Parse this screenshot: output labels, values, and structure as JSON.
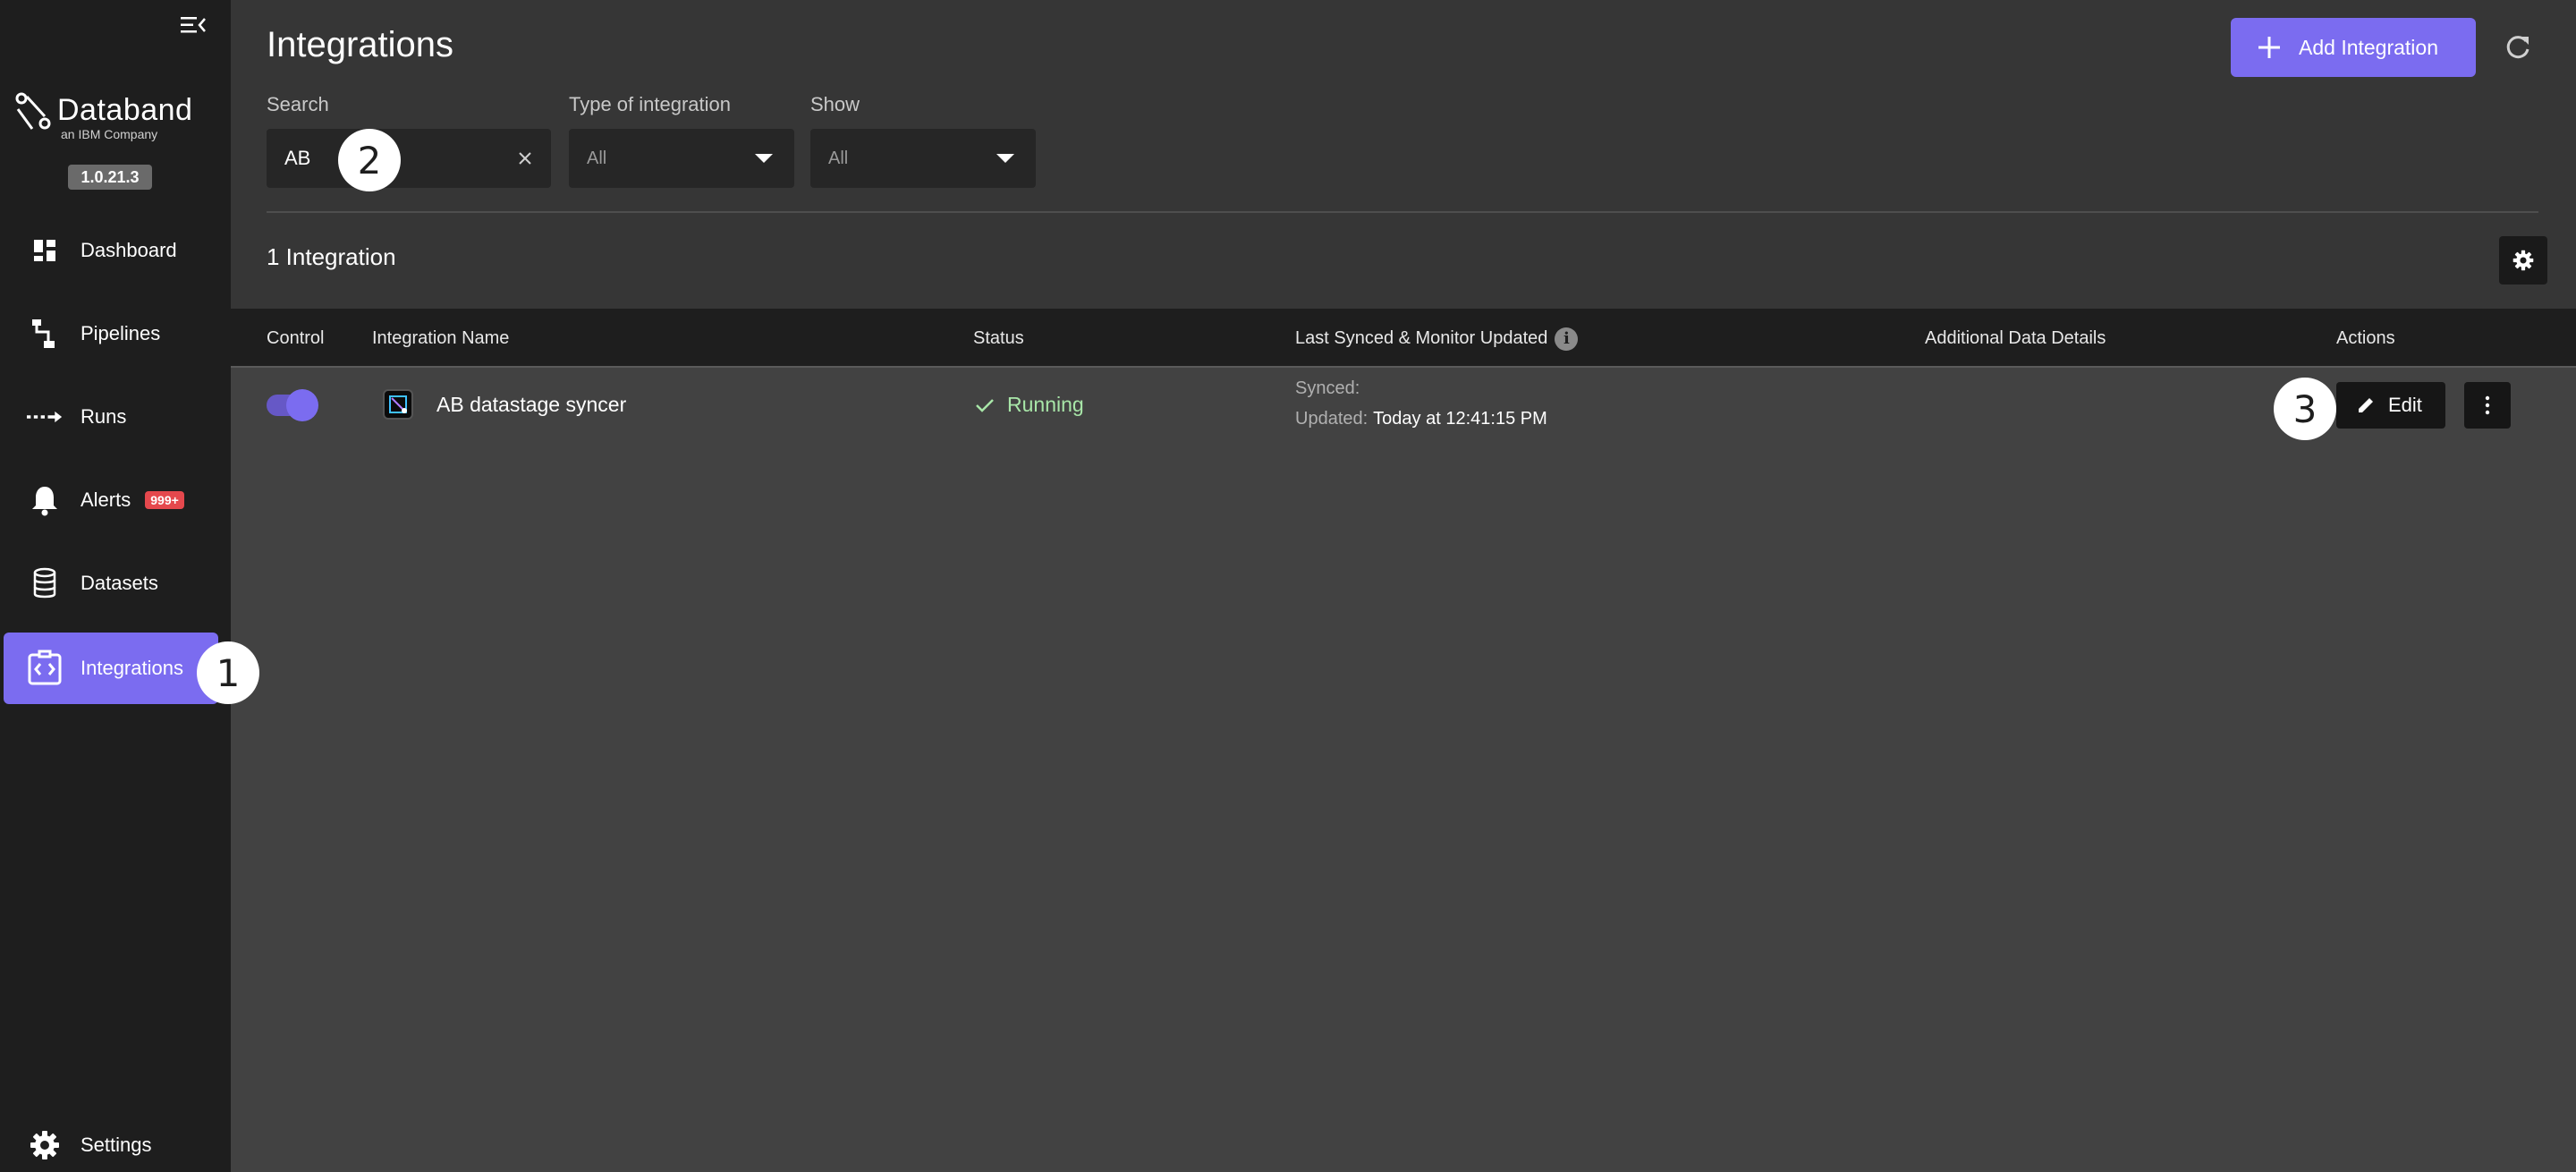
{
  "sidebar": {
    "brand": {
      "name": "Databand",
      "subtitle": "an IBM Company",
      "version": "1.0.21.3"
    },
    "items": [
      {
        "label": "Dashboard",
        "icon": "dashboard-icon"
      },
      {
        "label": "Pipelines",
        "icon": "pipelines-icon"
      },
      {
        "label": "Runs",
        "icon": "runs-icon"
      },
      {
        "label": "Alerts",
        "icon": "bell-icon",
        "badge": "999+"
      },
      {
        "label": "Datasets",
        "icon": "database-icon"
      },
      {
        "label": "Integrations",
        "icon": "integrations-icon",
        "active": true
      }
    ],
    "settings": {
      "label": "Settings",
      "icon": "gear-icon"
    }
  },
  "header": {
    "title": "Integrations",
    "add_button": "Add Integration"
  },
  "filters": {
    "search": {
      "label": "Search",
      "value": "AB"
    },
    "type": {
      "label": "Type of integration",
      "value": "All"
    },
    "show": {
      "label": "Show",
      "value": "All"
    }
  },
  "summary": {
    "count_text": "1 Integration"
  },
  "table": {
    "columns": [
      "Control",
      "Integration Name",
      "Status",
      "Last Synced & Monitor Updated",
      "Additional Data Details",
      "Actions"
    ],
    "rows": [
      {
        "control_enabled": true,
        "name": "AB datastage syncer",
        "status": "Running",
        "synced_label": "Synced:",
        "synced_value": "",
        "updated_label": "Updated:",
        "updated_value": "Today at 12:41:15 PM",
        "edit_label": "Edit"
      }
    ]
  },
  "annotations": {
    "marker_1": "1",
    "marker_2": "2",
    "marker_3": "3"
  },
  "colors": {
    "accent": "#7b6cf0",
    "sidebar_bg": "#1e1e1e",
    "content_bg": "#424242",
    "status_running": "#a8e6a8",
    "alert_badge": "#e5484d"
  }
}
